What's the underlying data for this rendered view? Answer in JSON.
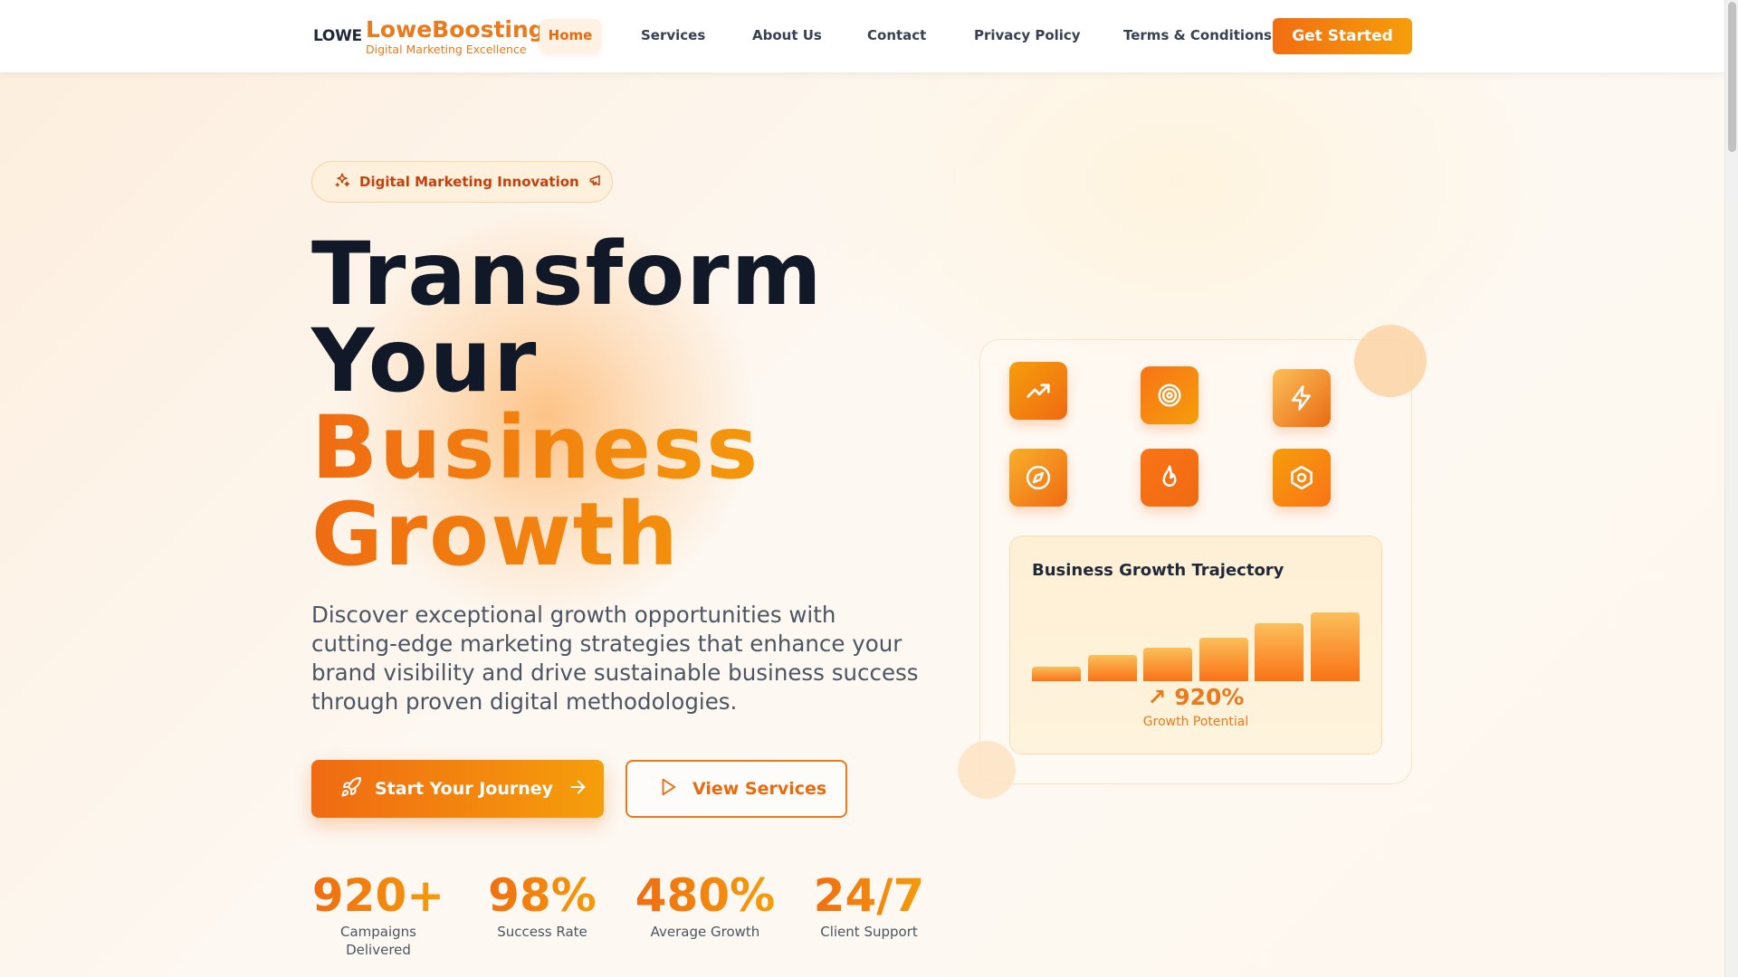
{
  "nav": {
    "logo_mark": "LOWE",
    "brand_name": "LoweBoosting",
    "brand_tagline": "Digital Marketing Excellence",
    "links": [
      "Home",
      "Services",
      "About Us",
      "Contact",
      "Privacy Policy",
      "Terms & Conditions"
    ],
    "active": "Home",
    "cta": "Get Started"
  },
  "hero": {
    "badge": "Digital Marketing Innovation",
    "title_line1": "Transform",
    "title_line2": "Your",
    "title_line3": "Business",
    "title_line4": "Growth",
    "description": "Discover exceptional growth opportunities with cutting-edge marketing strategies that enhance your brand visibility and drive sustainable business success through proven digital methodologies.",
    "primary_cta": "Start Your Journey",
    "secondary_cta": "View Services"
  },
  "stats": [
    {
      "value": "920+",
      "label": "Campaigns Delivered"
    },
    {
      "value": "98%",
      "label": "Success Rate"
    },
    {
      "value": "480%",
      "label": "Average Growth"
    },
    {
      "value": "24/7",
      "label": "Client Support"
    }
  ],
  "feature_icons": [
    "trending-up-icon",
    "target-icon",
    "zap-icon",
    "compass-icon",
    "flame-icon",
    "hexagon-icon"
  ],
  "chart_data": {
    "type": "bar",
    "title": "Business Growth Trajectory",
    "values": [
      12,
      22,
      28,
      37,
      49,
      58
    ],
    "headline": "↗ 920%",
    "headline_label": "Growth Potential"
  },
  "colors": {
    "accent": "#ea7a1b",
    "accent_dark": "#f06a12",
    "accent_light": "#f59e0b",
    "text_dark": "#111827",
    "text_muted": "#4b5563"
  }
}
